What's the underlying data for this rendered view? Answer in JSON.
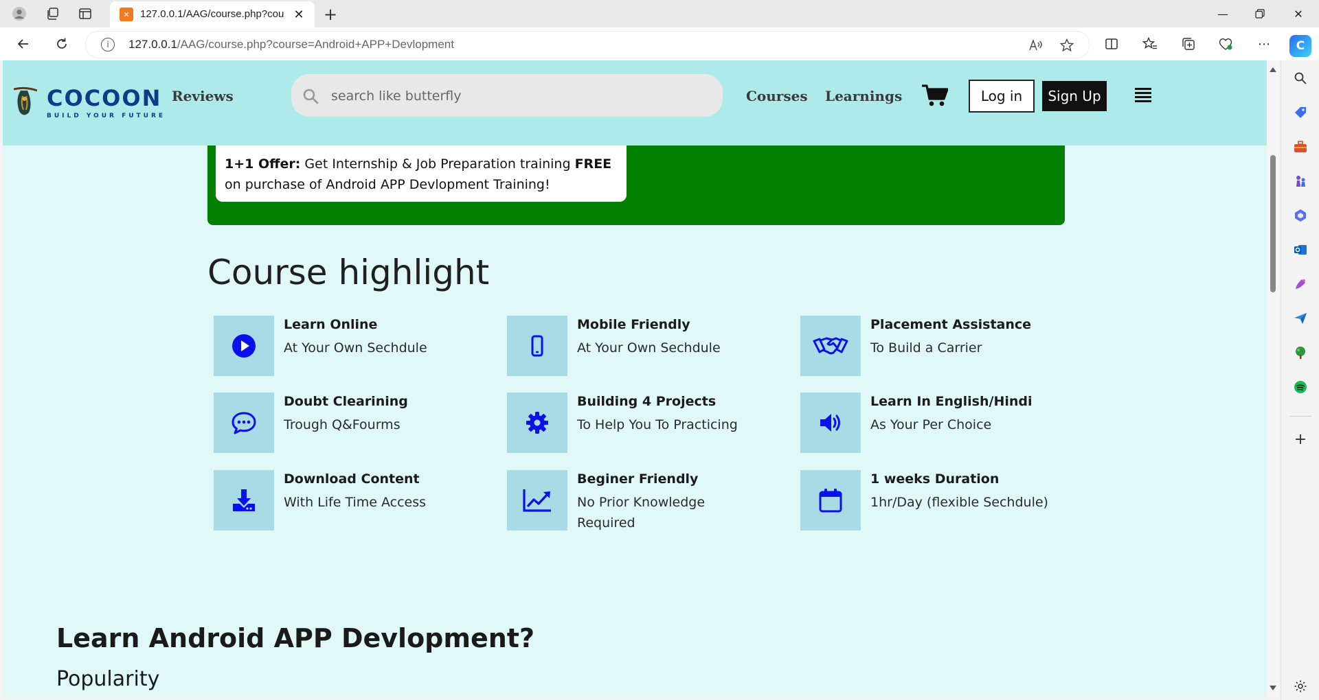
{
  "browser": {
    "tab_title": "127.0.0.1/AAG/course.php?course=Android+APP+Devlopment",
    "tab_favicon": "xampp-icon",
    "new_tab_label": "+",
    "url_host": "127.0.0.1",
    "url_path": "/AAG/course.php?course=Android+APP+Devlopment"
  },
  "site": {
    "logo_word": "COCOON",
    "logo_tagline": "BUILD YOUR FUTURE",
    "nav": {
      "reviews": "Reviews",
      "courses": "Courses",
      "learnings": "Learnings"
    },
    "search_placeholder": "search like butterfly",
    "login_label": "Log in",
    "signup_label": "Sign Up"
  },
  "offer": {
    "prefix": "1+1 Offer:",
    "text_a": " Get Internship & Job Preparation training ",
    "free": "FREE",
    "text_b": " on purchase of Android APP Devlopment Training!"
  },
  "highlights": {
    "title": "Course highlight",
    "items": [
      {
        "icon": "play-circle-icon",
        "title": "Learn Online",
        "subtitle": "At Your Own Sechdule"
      },
      {
        "icon": "mobile-phone-icon",
        "title": "Mobile Friendly",
        "subtitle": "At Your Own Sechdule"
      },
      {
        "icon": "handshake-icon",
        "title": "Placement Assistance",
        "subtitle": "To Build a Carrier"
      },
      {
        "icon": "chat-bubble-icon",
        "title": "Doubt Clearining",
        "subtitle": "Trough Q&Fourms"
      },
      {
        "icon": "gear-icon",
        "title": "Building 4 Projects",
        "subtitle": "To Help You To Practicing"
      },
      {
        "icon": "speaker-icon",
        "title": "Learn In English/Hindi",
        "subtitle": "As Your Per Choice"
      },
      {
        "icon": "download-icon",
        "title": "Download Content",
        "subtitle": "With Life Time Access"
      },
      {
        "icon": "trend-chart-icon",
        "title": "Beginer Friendly",
        "subtitle": "No Prior Knowledge Required"
      },
      {
        "icon": "calendar-icon",
        "title": "1 weeks Duration",
        "subtitle": "1hr/Day (flexible Sechdule)"
      }
    ]
  },
  "learn": {
    "title": "Learn Android APP Devlopment?",
    "subtitle": "Popularity"
  },
  "colors": {
    "header_bg": "#aeeaea",
    "page_bg": "#e1f8f8",
    "offer_green": "#028002",
    "icon_blue": "#0a10e8",
    "icon_box": "#a9dbe6"
  }
}
